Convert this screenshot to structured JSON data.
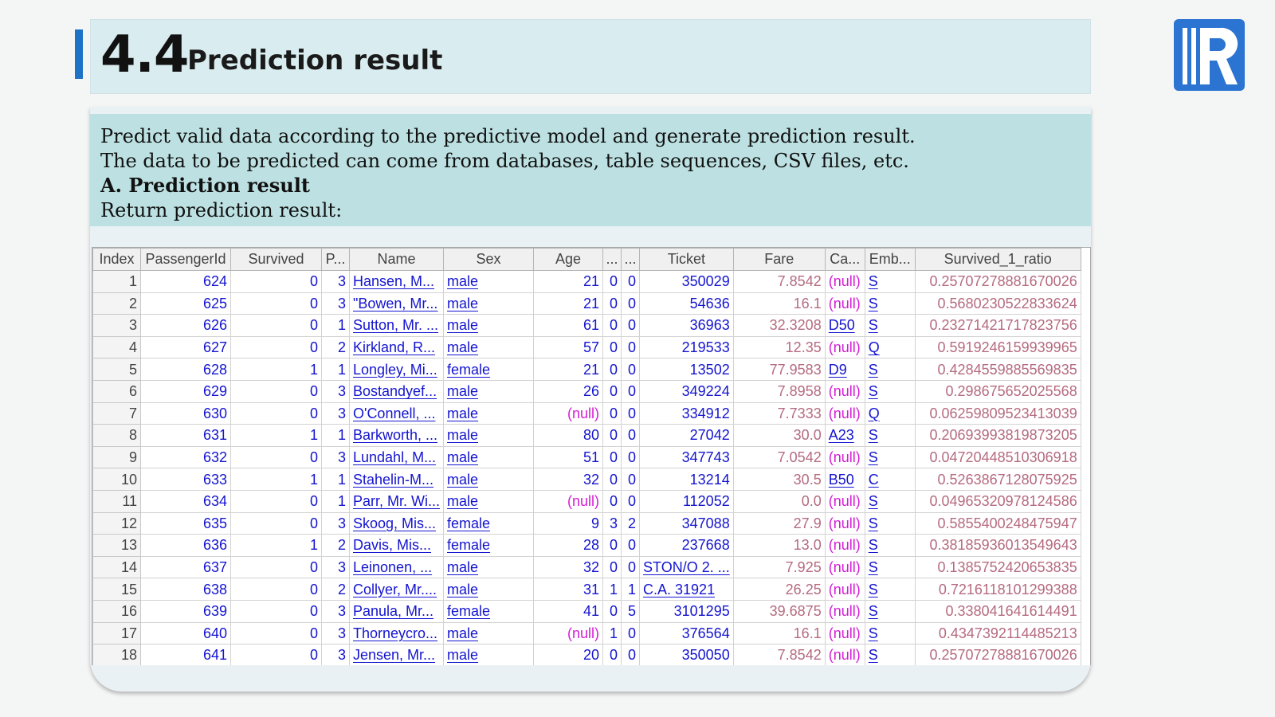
{
  "header": {
    "number": "4.4",
    "title": "Prediction result"
  },
  "logo": {
    "name": "R logo",
    "color": "#2b74d2"
  },
  "description": {
    "lines": [
      "Predict valid data according to the predictive model and generate prediction result.",
      "The data to be predicted can come from databases, table sequences, CSV files, etc.",
      "A. Prediction result",
      "Return prediction result:"
    ]
  },
  "table": {
    "columns": [
      "Index",
      "PassengerId",
      "Survived",
      "P...",
      "Name",
      "Sex",
      "Age",
      "...",
      "...",
      "Ticket",
      "Fare",
      "Ca...",
      "Emb...",
      "Survived_1_ratio"
    ],
    "rows": [
      [
        "1",
        "624",
        "0",
        "3",
        "Hansen, M...",
        "male",
        "21",
        "0",
        "0",
        "350029",
        "7.8542",
        "(null)",
        "S",
        "0.25707278881670026"
      ],
      [
        "2",
        "625",
        "0",
        "3",
        "\"Bowen, Mr...",
        "male",
        "21",
        "0",
        "0",
        "54636",
        "16.1",
        "(null)",
        "S",
        "0.5680230522833624"
      ],
      [
        "3",
        "626",
        "0",
        "1",
        "Sutton, Mr. ...",
        "male",
        "61",
        "0",
        "0",
        "36963",
        "32.3208",
        "D50",
        "S",
        "0.23271421717823756"
      ],
      [
        "4",
        "627",
        "0",
        "2",
        "Kirkland, R...",
        "male",
        "57",
        "0",
        "0",
        "219533",
        "12.35",
        "(null)",
        "Q",
        "0.5919246159939965"
      ],
      [
        "5",
        "628",
        "1",
        "1",
        "Longley, Mi...",
        "female",
        "21",
        "0",
        "0",
        "13502",
        "77.9583",
        "D9",
        "S",
        "0.4284559885569835"
      ],
      [
        "6",
        "629",
        "0",
        "3",
        "Bostandyef...",
        "male",
        "26",
        "0",
        "0",
        "349224",
        "7.8958",
        "(null)",
        "S",
        "0.298675652025568"
      ],
      [
        "7",
        "630",
        "0",
        "3",
        "O'Connell, ...",
        "male",
        "(null)",
        "0",
        "0",
        "334912",
        "7.7333",
        "(null)",
        "Q",
        "0.06259809523413039"
      ],
      [
        "8",
        "631",
        "1",
        "1",
        "Barkworth, ...",
        "male",
        "80",
        "0",
        "0",
        "27042",
        "30.0",
        "A23",
        "S",
        "0.20693993819873205"
      ],
      [
        "9",
        "632",
        "0",
        "3",
        "Lundahl, M...",
        "male",
        "51",
        "0",
        "0",
        "347743",
        "7.0542",
        "(null)",
        "S",
        "0.04720448510306918"
      ],
      [
        "10",
        "633",
        "1",
        "1",
        "Stahelin-M...",
        "male",
        "32",
        "0",
        "0",
        "13214",
        "30.5",
        "B50",
        "C",
        "0.5263867128075925"
      ],
      [
        "11",
        "634",
        "0",
        "1",
        "Parr, Mr. Wi...",
        "male",
        "(null)",
        "0",
        "0",
        "112052",
        "0.0",
        "(null)",
        "S",
        "0.04965320978124586"
      ],
      [
        "12",
        "635",
        "0",
        "3",
        "Skoog, Mis...",
        "female",
        "9",
        "3",
        "2",
        "347088",
        "27.9",
        "(null)",
        "S",
        "0.5855400248475947"
      ],
      [
        "13",
        "636",
        "1",
        "2",
        "Davis, Mis...",
        "female",
        "28",
        "0",
        "0",
        "237668",
        "13.0",
        "(null)",
        "S",
        "0.38185936013549643"
      ],
      [
        "14",
        "637",
        "0",
        "3",
        "Leinonen, ...",
        "male",
        "32",
        "0",
        "0",
        "STON/O 2. ...",
        "7.925",
        "(null)",
        "S",
        "0.1385752420653835"
      ],
      [
        "15",
        "638",
        "0",
        "2",
        "Collyer, Mr....",
        "male",
        "31",
        "1",
        "1",
        "C.A. 31921",
        "26.25",
        "(null)",
        "S",
        "0.7216118101299388"
      ],
      [
        "16",
        "639",
        "0",
        "3",
        "Panula, Mr...",
        "female",
        "41",
        "0",
        "5",
        "3101295",
        "39.6875",
        "(null)",
        "S",
        "0.338041641614491"
      ],
      [
        "17",
        "640",
        "0",
        "3",
        "Thorneycro...",
        "male",
        "(null)",
        "1",
        "0",
        "376564",
        "16.1",
        "(null)",
        "S",
        "0.4347392114485213"
      ],
      [
        "18",
        "641",
        "0",
        "3",
        "Jensen, Mr...",
        "male",
        "20",
        "0",
        "0",
        "350050",
        "7.8542",
        "(null)",
        "S",
        "0.25707278881670026"
      ]
    ]
  }
}
